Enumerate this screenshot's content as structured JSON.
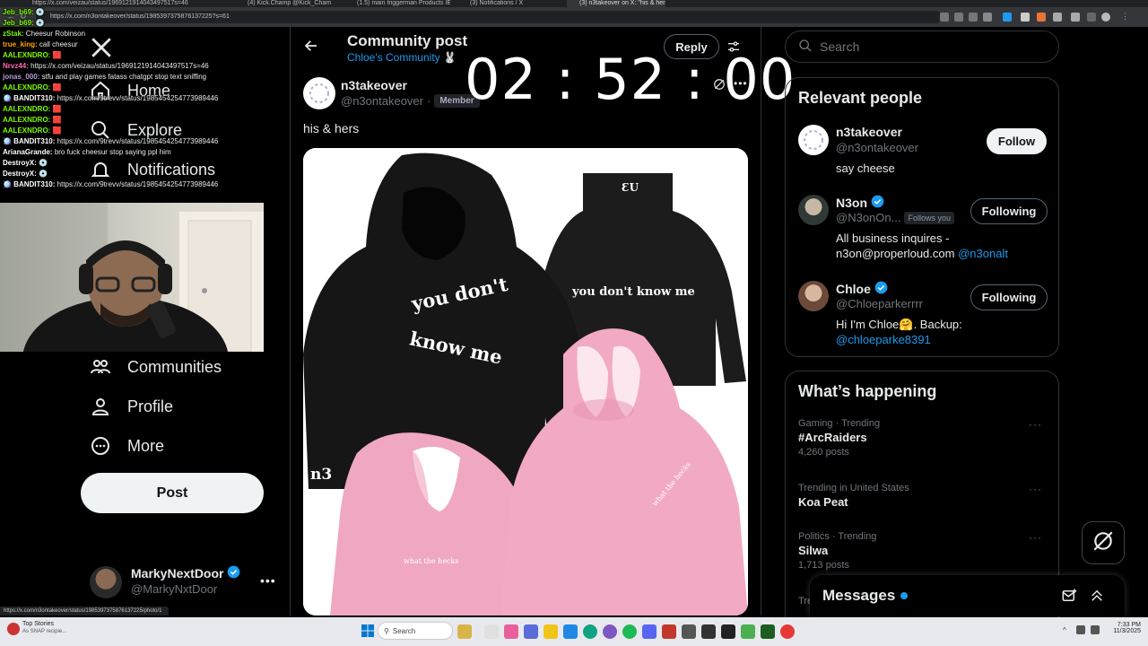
{
  "browser": {
    "tabs": [
      "https://x.com/veizau/status/1969121914043497517s=46",
      "(4) Kick.Champ @Kick_Cham",
      "(1.5) main triggerman Products IE",
      "(3) Notifications / X",
      "(3) n3takeover on X: \"his & hers\""
    ],
    "url": "https://x.com/n3ontakeover/status/1985397375876137225?s=61",
    "status_url": "https://x.com/n3ontakeover/status/1985397375876137225/photo/1"
  },
  "chat": [
    {
      "user": "Jeb_b69:",
      "color": "#7cfc00",
      "text": "💿"
    },
    {
      "user": "Jeb_b69:",
      "color": "#7cfc00",
      "text": "💿"
    },
    {
      "user": "zStak:",
      "color": "#7cfc00",
      "text": "Cheesur Robinson"
    },
    {
      "user": "true_king:",
      "color": "#ffa500",
      "text": "call cheesur"
    },
    {
      "user": "AALEXNDRO:",
      "color": "#7cfc00",
      "text": "🟥"
    },
    {
      "user": "Nrvz44:",
      "color": "#ff69b4",
      "text": "https://x.com/veizau/status/1969121914043497517s=46"
    },
    {
      "user": "jonas_000:",
      "color": "#b39ddb",
      "text": "stfu and play games fatass chatgpt stop text sniffing"
    },
    {
      "user": "AALEXNDRO:",
      "color": "#7cfc00",
      "text": "🟥"
    },
    {
      "user": "🪩 BANDIT310:",
      "color": "#ffffff",
      "text": "https://x.com/9trevv/status/1985454254773989446"
    },
    {
      "user": "AALEXNDRO:",
      "color": "#7cfc00",
      "text": "🟥"
    },
    {
      "user": "AALEXNDRO:",
      "color": "#7cfc00",
      "text": "🟥"
    },
    {
      "user": "AALEXNDRO:",
      "color": "#7cfc00",
      "text": "🟥"
    },
    {
      "user": "🪩 BANDIT310:",
      "color": "#ffffff",
      "text": "https://x.com/9trevv/status/1985454254773989446"
    },
    {
      "user": "ArianaGrande:",
      "color": "#ffffff",
      "text": "bro fuck cheesur stop saying ppl him"
    },
    {
      "user": "DestroyX:",
      "color": "#ffffff",
      "text": "💿"
    },
    {
      "user": "DestroyX:",
      "color": "#ffffff",
      "text": "💿"
    },
    {
      "user": "🪩 BANDIT310:",
      "color": "#ffffff",
      "text": "https://x.com/9trevv/status/1985454254773989446"
    }
  ],
  "nav": {
    "home": "Home",
    "explore": "Explore",
    "notifications": "Notifications",
    "communities": "Communities",
    "profile": "Profile",
    "more": "More",
    "post_button": "Post"
  },
  "account": {
    "name": "MarkyNextDoor",
    "handle": "@MarkyNxtDoor"
  },
  "post": {
    "header_title": "Community post",
    "community": "Chloe's Community 🐰",
    "reply": "Reply",
    "author_name": "n3takeover",
    "author_handle": "@n3ontakeover",
    "separator": "·",
    "badge": "Member",
    "text": "his & hers",
    "timer": "02 : 52 : 00",
    "hoodie_text_black_left_1": "you don't",
    "hoodie_text_black_left_2": "know me",
    "hoodie_text_black_right": "you don't know me",
    "hoodie_brand": "n3",
    "hoodie_text_pink_left": "what the hecks",
    "hoodie_text_pink_right": "what the hecks",
    "hoodie_mark": "ƐU"
  },
  "search": {
    "placeholder": "Search"
  },
  "relevant": {
    "title": "Relevant people",
    "people": [
      {
        "name": "n3takeover",
        "handle": "@n3ontakeover",
        "button": "Follow",
        "bio": "say cheese",
        "verified": false,
        "follows_you": ""
      },
      {
        "name": "N3on",
        "handle": "@N3onOn...",
        "button": "Following",
        "bio": "All business inquires - n3on@properloud.com",
        "bio_link": "@n3onalt",
        "verified": true,
        "follows_you": "Follows you"
      },
      {
        "name": "Chloe",
        "handle": "@Chloeparkerrrr",
        "button": "Following",
        "bio": "Hi I'm Chloe🤗. Backup:",
        "bio_link": "@chloeparke8391",
        "verified": true,
        "follows_you": ""
      }
    ]
  },
  "happening": {
    "title": "What’s happening",
    "trends": [
      {
        "meta": "Gaming · Trending",
        "name": "#ArcRaiders",
        "count": "4,260 posts"
      },
      {
        "meta": "Trending in United States",
        "name": "Koa Peat",
        "count": ""
      },
      {
        "meta": "Politics · Trending",
        "name": "Silwa",
        "count": "1,713 posts"
      }
    ],
    "more": "···",
    "partial_meta": "Tre"
  },
  "messages": {
    "label": "Messages"
  },
  "taskbar": {
    "news_title": "Top Stories",
    "news_sub": "As SNAP recipie...",
    "search": "Search",
    "time": "7:33 PM",
    "date": "11/3/2025"
  },
  "colors": {
    "accent": "#1d9bf0",
    "text": "#e7e9ea",
    "muted": "#71767b",
    "border": "#2f3336",
    "community": "#1d9bf0"
  }
}
